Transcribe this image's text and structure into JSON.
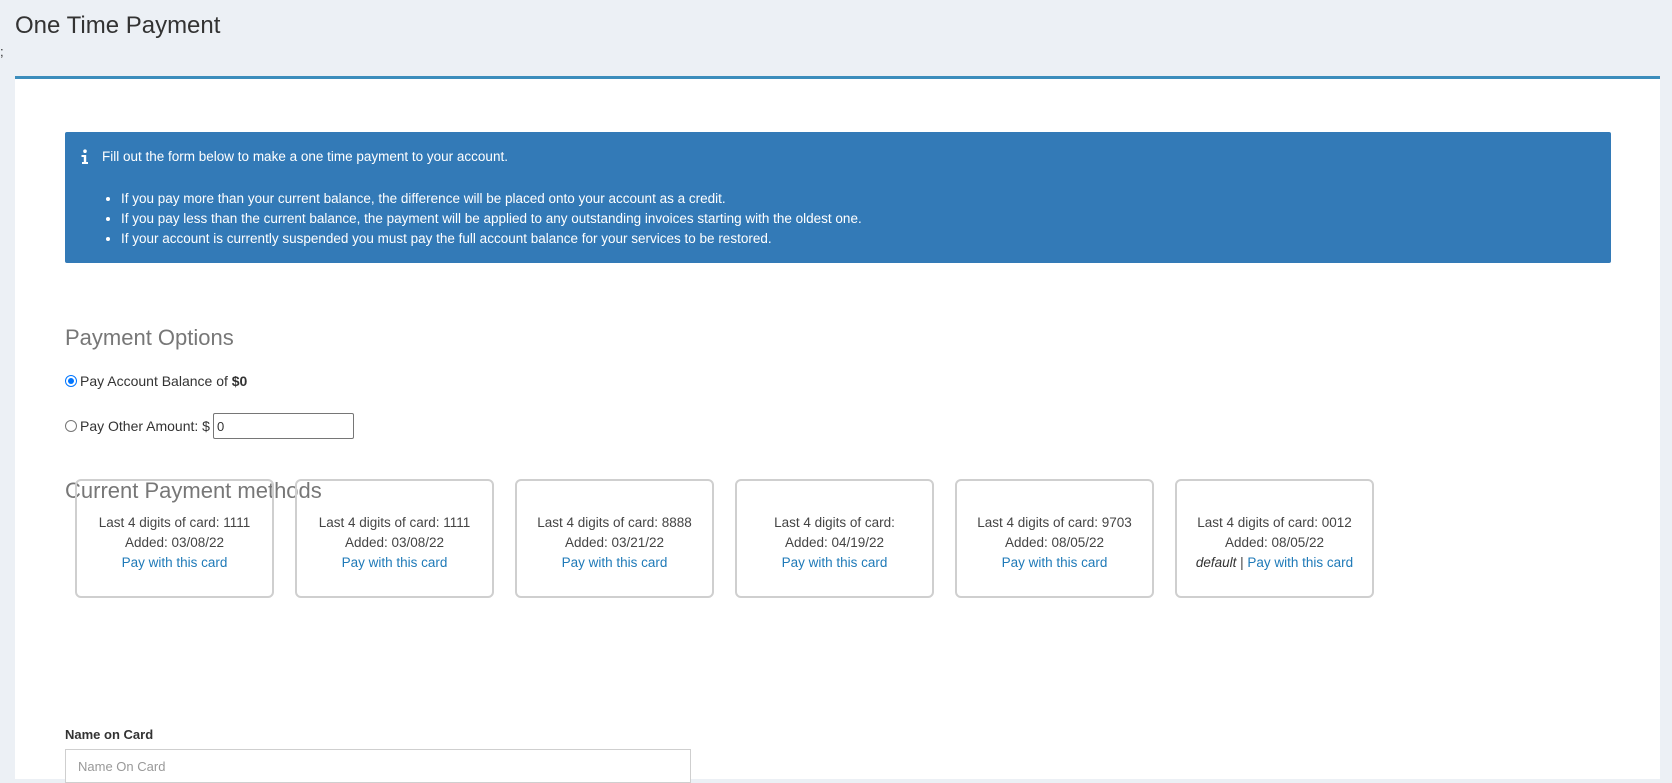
{
  "stray_mark": ";",
  "page": {
    "title": "One Time Payment"
  },
  "callout": {
    "icon": "info-icon",
    "intro": "Fill out the form below to make a one time payment to your account.",
    "items": [
      "If you pay more than your current balance, the difference will be placed onto your account as a credit.",
      "If you pay less than the current balance, the payment will be applied to any outstanding invoices starting with the oldest one.",
      "If your account is currently suspended you must pay the full account balance for your services to be restored."
    ]
  },
  "payment_options": {
    "title": "Payment Options",
    "balance_label": "Pay Account Balance of ",
    "balance_amount": "$0",
    "balance_selected": true,
    "other_label": "Pay Other Amount: $",
    "other_value": "0",
    "other_selected": false
  },
  "payment_methods": {
    "title": "Current Payment methods",
    "cards": [
      {
        "digits_label": "Last 4 digits of card: 1111",
        "added": "Added: 03/08/22",
        "default_label": "",
        "action": "Pay with this card"
      },
      {
        "digits_label": "Last 4 digits of card: 1111",
        "added": "Added: 03/08/22",
        "default_label": "",
        "action": "Pay with this card"
      },
      {
        "digits_label": "Last 4 digits of card: 8888",
        "added": "Added: 03/21/22",
        "default_label": "",
        "action": "Pay with this card"
      },
      {
        "digits_label": "Last 4 digits of card:",
        "added": "Added: 04/19/22",
        "default_label": "",
        "action": "Pay with this card"
      },
      {
        "digits_label": "Last 4 digits of card: 9703",
        "added": "Added: 08/05/22",
        "default_label": "",
        "action": "Pay with this card"
      },
      {
        "digits_label": "Last 4 digits of card: 0012",
        "added": "Added: 08/05/22",
        "default_label": "default",
        "separator": " | ",
        "action": "Pay with this card"
      }
    ]
  },
  "name_on_card": {
    "label": "Name on Card",
    "placeholder": "Name On Card"
  },
  "colors": {
    "accent": "#3c8dbc",
    "callout_bg": "#337ab7",
    "link": "#1f7ab8",
    "page_bg": "#ecf0f5"
  }
}
